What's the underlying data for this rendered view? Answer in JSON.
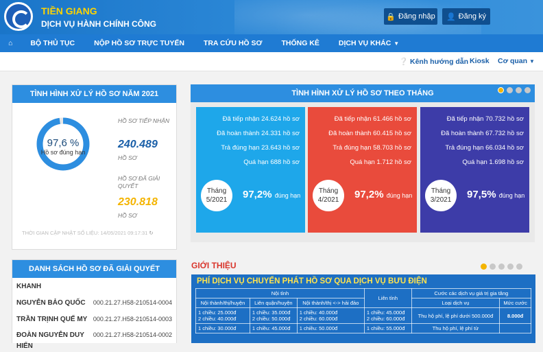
{
  "header": {
    "org_name": "TIỀN GIANG",
    "subtitle": "DỊCH VỤ HÀNH CHÍNH CÔNG",
    "login_label": "Đăng nhập",
    "register_label": "Đăng ký"
  },
  "nav": {
    "items": [
      "BỘ THỦ TỤC",
      "NỘP HỒ SƠ TRỰC TUYẾN",
      "TRA CỨU HỒ SƠ",
      "THỐNG KÊ",
      "DỊCH VỤ KHÁC"
    ]
  },
  "subbar": {
    "guide_label": "Kênh hướng dẫn",
    "kiosk_label": "Kiosk",
    "agency_label": "Cơ quan"
  },
  "year_panel": {
    "title": "TÌNH HÌNH XỬ LÝ HỒ SƠ NĂM 2021",
    "donut_percent": "97,6 %",
    "donut_caption": "Hồ sơ đúng hạn",
    "donut_fraction": 0.976,
    "received_label": "HỒ SƠ TIẾP NHẬN",
    "received_value": "240.489",
    "received_unit": "HỒ SƠ",
    "resolved_label": "HỒ SƠ ĐÃ GIẢI QUYẾT",
    "resolved_value": "230.818",
    "resolved_unit": "HỒ SƠ",
    "update_note": "THỜI GIAN CẬP NHẬT SỐ LIỆU: 14/05/2021 09:17:31"
  },
  "month_panel": {
    "title": "TÌNH HÌNH XỬ LÝ HỒ SƠ THEO THÁNG",
    "cards": [
      {
        "color": "#1ea7ea",
        "received": "Đã tiếp nhận 24.624 hồ sơ",
        "done": "Đã hoàn thành 24.331 hồ sơ",
        "ontime": "Trả đúng hạn 23.643 hồ sơ",
        "late": "Quá hạn 688 hồ sơ",
        "month_label": "Tháng",
        "month": "5/2021",
        "pct": "97,2%",
        "pct_caption": "đúng hạn"
      },
      {
        "color": "#e94b3c",
        "received": "Đã tiếp nhận 61.466 hồ sơ",
        "done": "Đã hoàn thành 60.415 hồ sơ",
        "ontime": "Trả đúng hạn 58.703 hồ sơ",
        "late": "Quá hạn 1.712 hồ sơ",
        "month_label": "Tháng",
        "month": "4/2021",
        "pct": "97,2%",
        "pct_caption": "đúng hạn"
      },
      {
        "color": "#3d3ca8",
        "received": "Đã tiếp nhận 70.732 hồ sơ",
        "done": "Đã hoàn thành 67.732 hồ sơ",
        "ontime": "Trả đúng hạn 66.034 hồ sơ",
        "late": "Quá hạn 1.698 hồ sơ",
        "month_label": "Tháng",
        "month": "3/2021",
        "pct": "97,5%",
        "pct_caption": "đúng hạn"
      }
    ]
  },
  "resolved_list": {
    "title": "DANH SÁCH HỒ SƠ ĐÃ GIẢI QUYẾT",
    "rows": [
      {
        "name": "KHANH",
        "code": ""
      },
      {
        "name": "NGUYỄN BẢO QUỐC",
        "code": "000.21.27.H58-210514-0004"
      },
      {
        "name": "TRẦN TRỊNH QUẾ MY",
        "code": "000.21.27.H58-210514-0003"
      },
      {
        "name": "ĐOÀN NGUYỄN DUY",
        "code": "000.21.27.H58-210514-0002"
      },
      {
        "name": "HIỂN",
        "code": ""
      }
    ]
  },
  "intro": {
    "title": "GIỚI THIỆU",
    "banner_title": "PHÍ DỊCH VỤ CHUYỂN PHÁT HỒ SƠ QUA DỊCH VỤ BƯU ĐIỆN",
    "col_noi_tinh": "Nội tỉnh",
    "col_lien_tinh": "Liên tỉnh",
    "col_gia_tang": "Cước các dịch vụ giá trị gia tăng",
    "sub_cols": [
      "Nội thành/thị/huyện",
      "Liên quận/huyện",
      "Nội thành/thị <-> hải đảo",
      "Loại dịch vụ",
      "Mức cước"
    ],
    "row1": [
      "1 chiều: 25.000đ",
      "1 chiều: 35.000đ",
      "1 chiều: 40.000đ",
      "1 chiều: 45.000đ",
      "Thu hộ phí, lệ phí dưới 500.000đ",
      "8.000đ"
    ],
    "row2": [
      "2 chiều: 40.000đ",
      "2 chiều: 50.000đ",
      "2 chiều: 60.000đ",
      "2 chiều: 60.000đ"
    ],
    "row3": [
      "1 chiều: 30.000đ",
      "1 chiều: 45.000đ",
      "1 chiều: 50.000đ",
      "1 chiều: 55.000đ",
      "Thu hộ phí, lệ phí từ"
    ]
  },
  "colors": {
    "brand_blue": "#1f7bd3",
    "accent_yellow": "#ffd400",
    "orange_value": "#f4b400",
    "intro_red": "#d9352b"
  }
}
